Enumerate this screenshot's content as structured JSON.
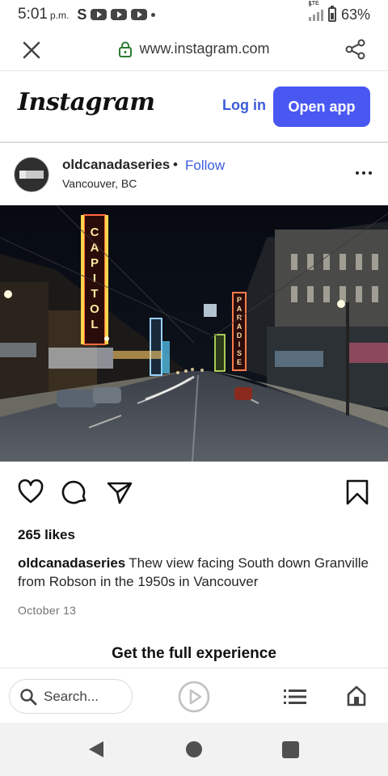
{
  "status_bar": {
    "time": "5:01",
    "ampm": "p.m.",
    "notification_s": "S",
    "network": "LTE",
    "battery": "63%"
  },
  "browser": {
    "url": "www.instagram.com",
    "search_placeholder": "Search..."
  },
  "ig_header": {
    "logo": "Instagram",
    "login_label": "Log in",
    "open_app_label": "Open app",
    "accent": "#4a58f2"
  },
  "post": {
    "username": "oldcanadaseries",
    "separator": "•",
    "follow_label": "Follow",
    "location": "Vancouver, BC",
    "likes": "265 likes",
    "caption_user": "oldcanadaseries",
    "caption_text": "Thew view facing South down Granville from Robson in the 1950s in Vancouver",
    "date": "October 13",
    "photo_signs": {
      "capitol": "CAPITOL",
      "paradise": "PARADISE"
    }
  },
  "promo": {
    "full_experience": "Get the full experience"
  },
  "icons": {
    "close": "close-icon",
    "lock": "lock-icon",
    "share": "share-icon",
    "more": "more-icon",
    "heart": "heart-icon",
    "comment": "comment-icon",
    "send": "send-icon",
    "bookmark": "bookmark-icon",
    "search": "search-icon",
    "play": "play-icon",
    "menu": "menu-icon",
    "home": "home-icon"
  }
}
